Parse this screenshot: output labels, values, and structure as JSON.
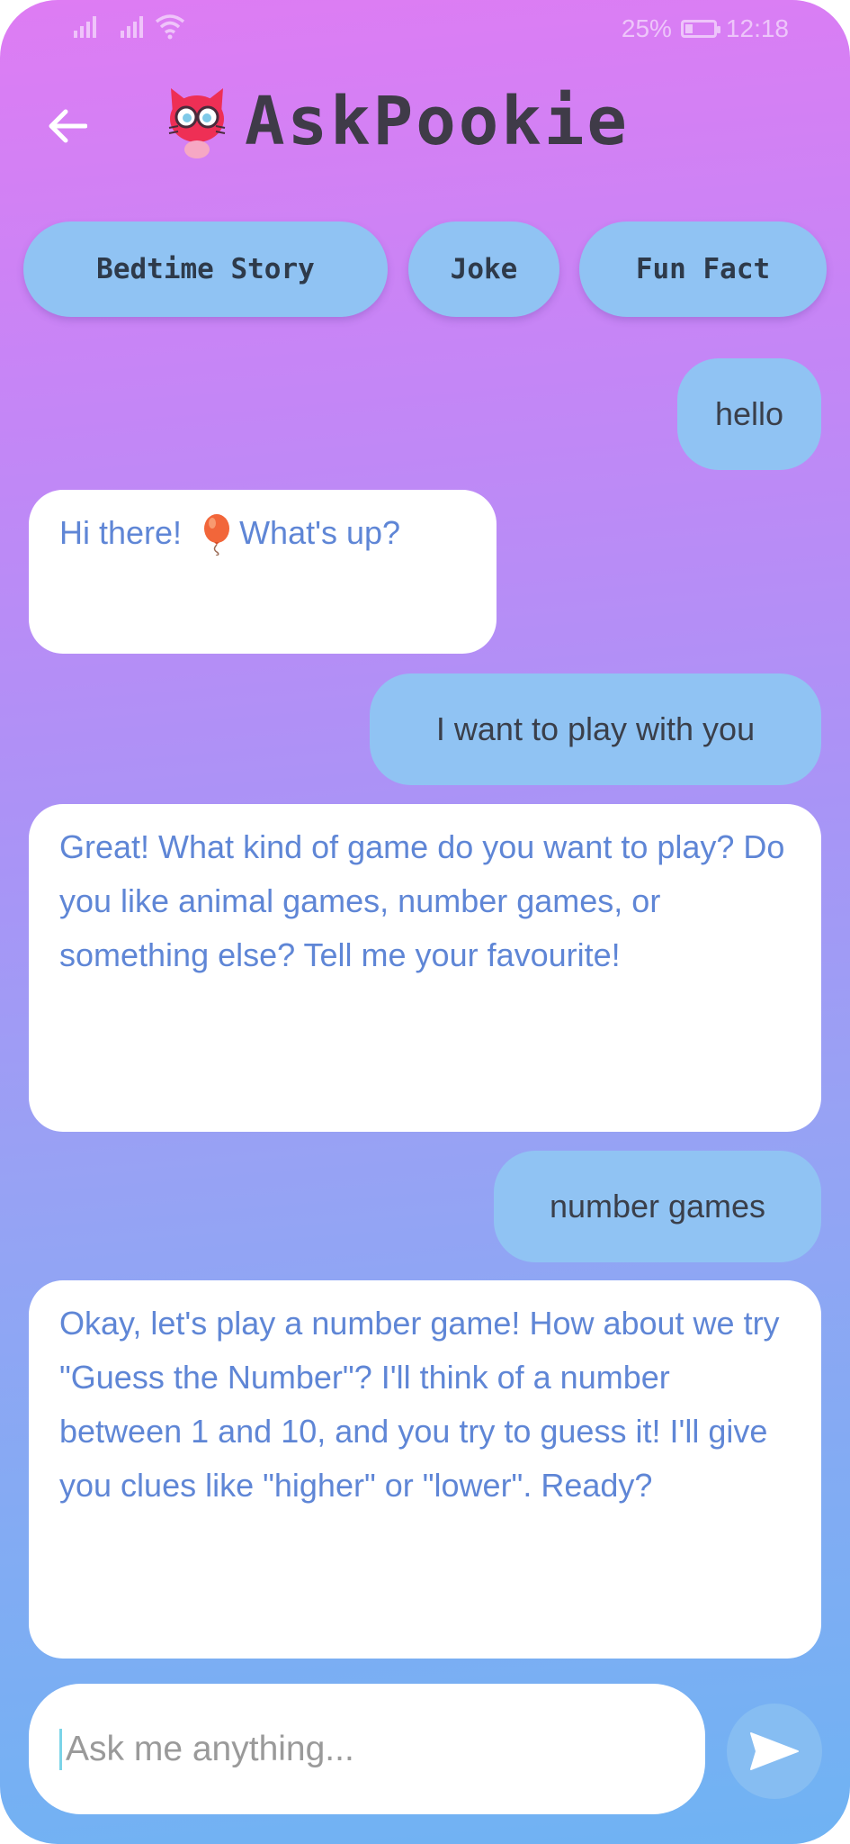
{
  "status_bar": {
    "battery": "25%",
    "time": "12:18"
  },
  "header": {
    "title": "AskPookie"
  },
  "quick_actions": [
    "Bedtime Story",
    "Joke",
    "Fun Fact"
  ],
  "messages": [
    {
      "role": "user",
      "text": "hello"
    },
    {
      "role": "bot",
      "text_before": "Hi there!",
      "text_after": "What's up?"
    },
    {
      "role": "user",
      "text": "I want to play with you"
    },
    {
      "role": "bot",
      "text": "Great! What kind of game do you want to play?  Do you like animal games, number games, or something else?  Tell me your favourite!"
    },
    {
      "role": "user",
      "text": "number games"
    },
    {
      "role": "bot",
      "text": "Okay, let's play a number game!  How about we try \"Guess the Number\"? I'll think of a number between 1 and 10, and you try to guess it!  I'll give you clues like \"higher\" or \"lower\". Ready?"
    }
  ],
  "composer": {
    "placeholder": "Ask me anything..."
  },
  "icons": [
    "signal-icon",
    "wifi-icon",
    "battery-icon",
    "back-arrow-icon",
    "cat-logo-icon",
    "balloon-icon",
    "send-icon"
  ],
  "colors": {
    "user_bubble": "#90c3f3",
    "bot_text": "#5f86d6",
    "chip": "#90c3f3",
    "send_button": "#86bdf2"
  }
}
